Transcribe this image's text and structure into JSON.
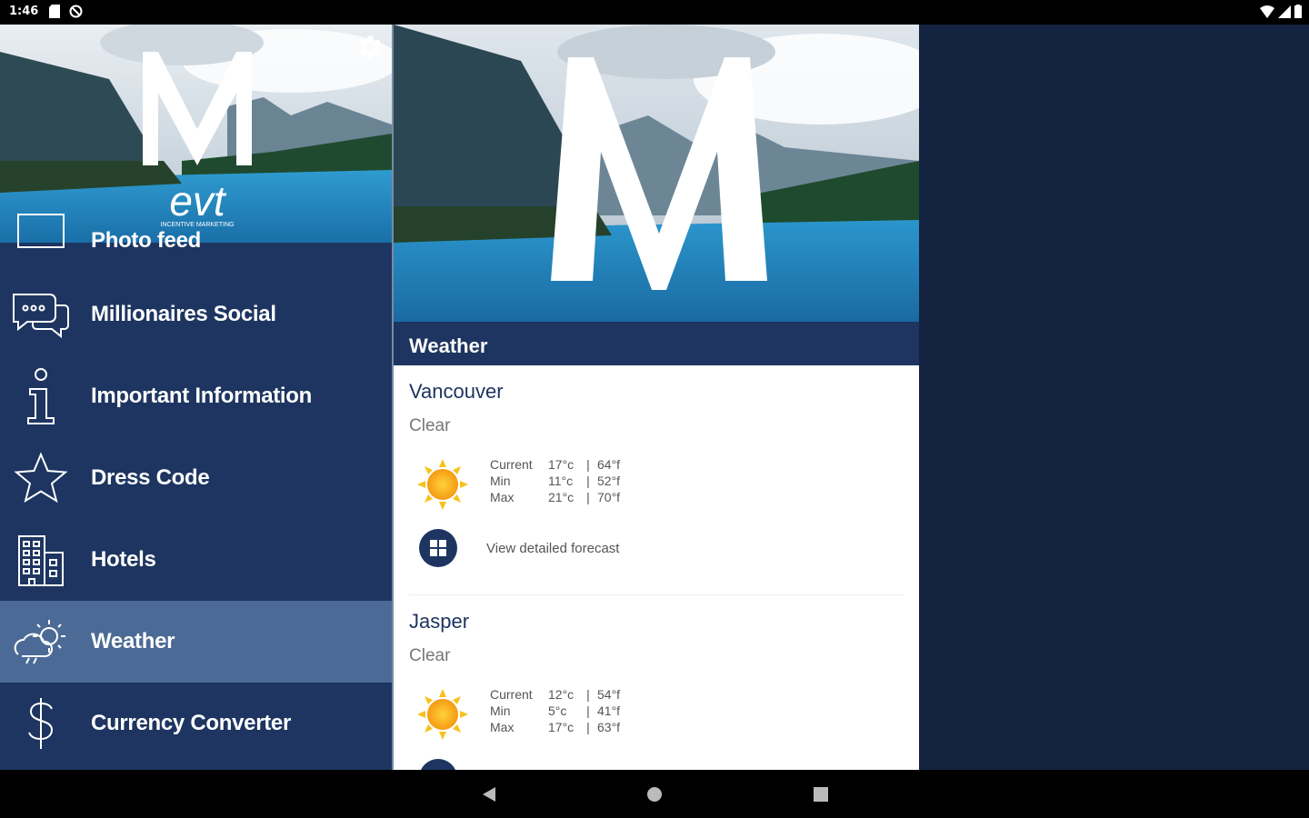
{
  "status": {
    "time": "1:46"
  },
  "drawer": {
    "partial_item": "Photo feed",
    "items": [
      {
        "label": "Millionaires Social",
        "icon": "chat-bubbles-icon"
      },
      {
        "label": "Important Information",
        "icon": "info-icon"
      },
      {
        "label": "Dress Code",
        "icon": "star-icon"
      },
      {
        "label": "Hotels",
        "icon": "building-icon"
      },
      {
        "label": "Weather",
        "icon": "weather-icon",
        "active": true
      },
      {
        "label": "Currency Converter",
        "icon": "dollar-icon"
      }
    ],
    "logo_letter": "M",
    "logo_sub": "evt",
    "logo_tagline": "INCENTIVE MARKETING"
  },
  "panel": {
    "hero_letter": "M",
    "title": "Weather",
    "cities": [
      {
        "name": "Vancouver",
        "condition": "Clear",
        "current_label": "Current",
        "current_c": "17°c",
        "current_f": "64°f",
        "min_label": "Min",
        "min_c": "11°c",
        "min_f": "52°f",
        "max_label": "Max",
        "max_c": "21°c",
        "max_f": "70°f",
        "forecast_label": "View detailed forecast"
      },
      {
        "name": "Jasper",
        "condition": "Clear",
        "current_label": "Current",
        "current_c": "12°c",
        "current_f": "54°f",
        "min_label": "Min",
        "min_c": "5°c",
        "min_f": "41°f",
        "max_label": "Max",
        "max_c": "17°c",
        "max_f": "63°f"
      }
    ]
  },
  "colors": {
    "navy": "#1d3560",
    "active": "#4b6a95",
    "background": "#14233f"
  }
}
